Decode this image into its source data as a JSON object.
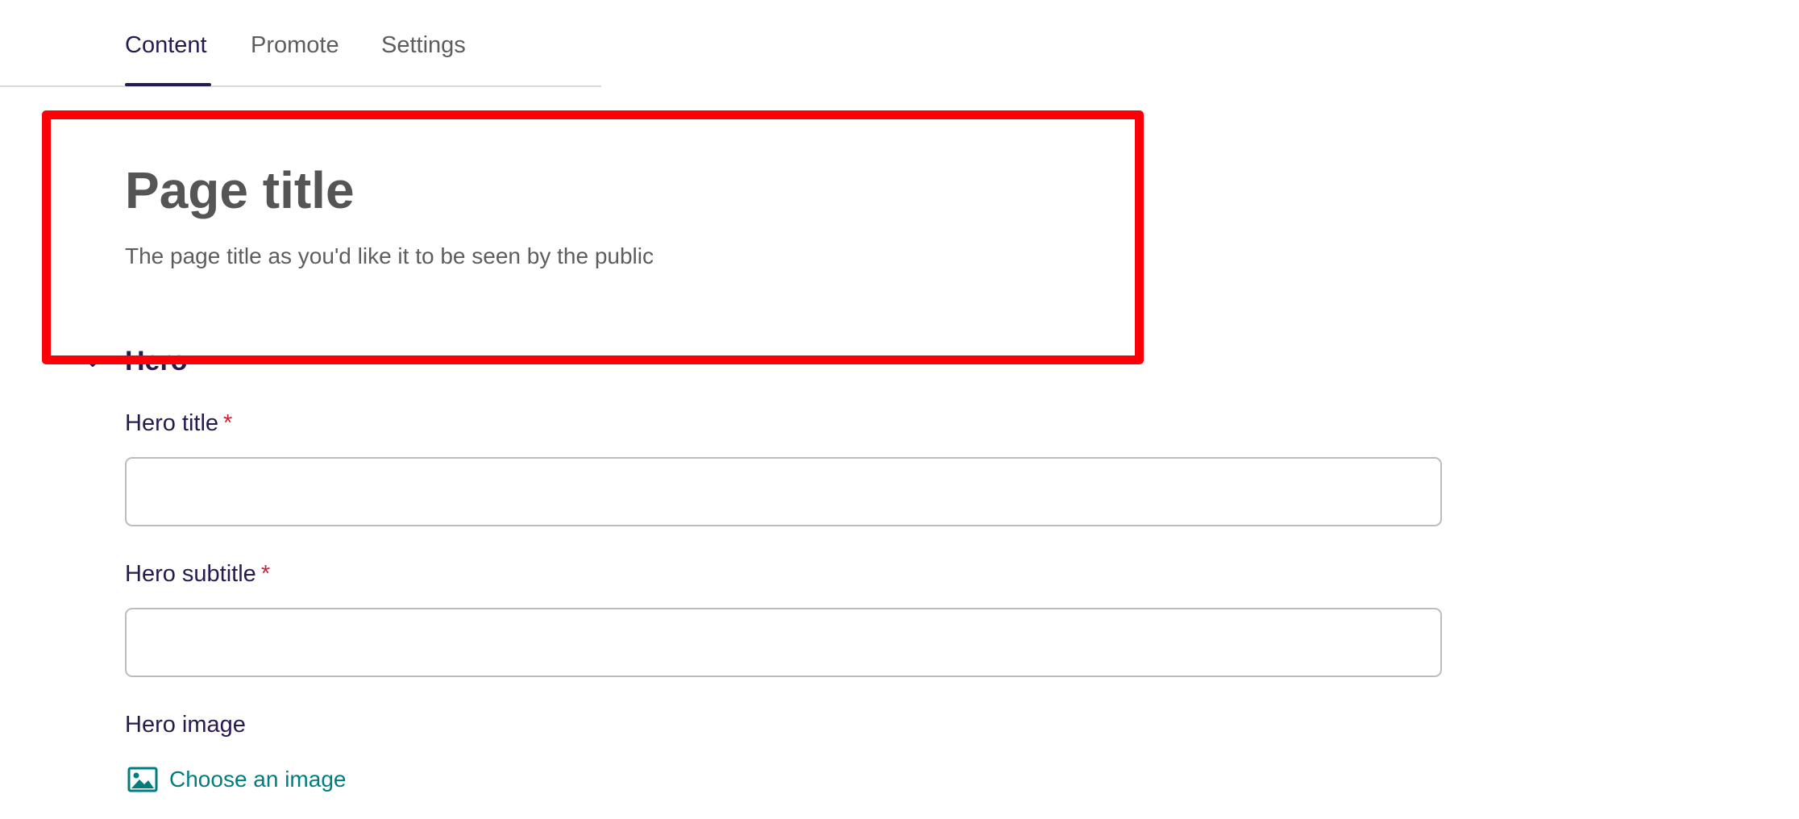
{
  "tabs": [
    {
      "label": "Content",
      "active": true
    },
    {
      "label": "Promote",
      "active": false
    },
    {
      "label": "Settings",
      "active": false
    }
  ],
  "page_title": {
    "heading": "Page title",
    "help_text": "The page title as you'd like it to be seen by the public"
  },
  "hero": {
    "section_heading": "Hero",
    "toggle_icon": "chevron-down-icon",
    "title_field": {
      "label": "Hero title",
      "required_marker": "*",
      "value": ""
    },
    "subtitle_field": {
      "label": "Hero subtitle",
      "required_marker": "*",
      "value": ""
    },
    "image_field": {
      "label": "Hero image",
      "choose_label": "Choose an image",
      "icon": "image-icon"
    }
  },
  "colors": {
    "highlight": "#fb0007",
    "primary_text": "#261a4f",
    "required": "#cd2131",
    "link": "#007d7e",
    "muted_text": "#5d5d5d",
    "input_border": "#bcbcbc"
  }
}
